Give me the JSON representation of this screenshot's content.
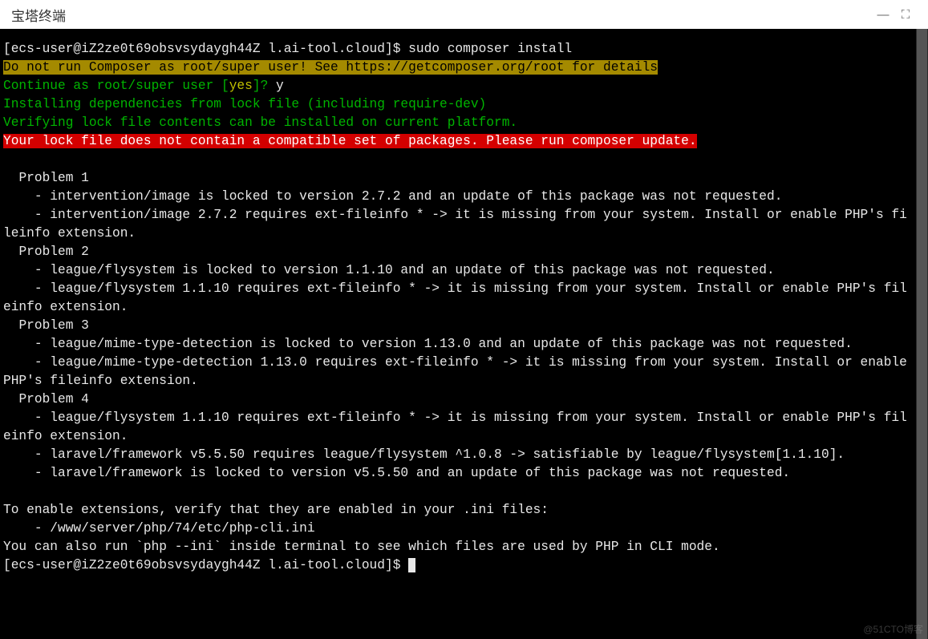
{
  "window": {
    "title": "宝塔终端",
    "minimize": "—",
    "expand": "⛶"
  },
  "term": {
    "prompt1_user": "[ecs-user@iZ2ze0t69obsvsydaygh44Z l.ai-tool.cloud]$ ",
    "cmd1": "sudo composer install",
    "root_warn": "Do not run Composer as root/super user! See https://getcomposer.org/root for details",
    "continue_q": "Continue as root/super user [",
    "continue_yes": "yes",
    "continue_q_end": "]? ",
    "continue_ans": "y",
    "install_dep": "Installing dependencies from lock file (including require-dev)",
    "verify": "Verifying lock file contents can be installed on current platform.",
    "lock_err": "Your lock file does not contain a compatible set of packages. Please run composer update.",
    "blank": " ",
    "p1_h": "  Problem 1",
    "p1_l1": "    - intervention/image is locked to version 2.7.2 and an update of this package was not requested.",
    "p1_l2": "    - intervention/image 2.7.2 requires ext-fileinfo * -> it is missing from your system. Install or enable PHP's fileinfo extension.",
    "p2_h": "  Problem 2",
    "p2_l1": "    - league/flysystem is locked to version 1.1.10 and an update of this package was not requested.",
    "p2_l2": "    - league/flysystem 1.1.10 requires ext-fileinfo * -> it is missing from your system. Install or enable PHP's fileinfo extension.",
    "p3_h": "  Problem 3",
    "p3_l1": "    - league/mime-type-detection is locked to version 1.13.0 and an update of this package was not requested.",
    "p3_l2": "    - league/mime-type-detection 1.13.0 requires ext-fileinfo * -> it is missing from your system. Install or enable PHP's fileinfo extension.",
    "p4_h": "  Problem 4",
    "p4_l1": "    - league/flysystem 1.1.10 requires ext-fileinfo * -> it is missing from your system. Install or enable PHP's fileinfo extension.",
    "p4_l2": "    - laravel/framework v5.5.50 requires league/flysystem ^1.0.8 -> satisfiable by league/flysystem[1.1.10].",
    "p4_l3": "    - laravel/framework is locked to version v5.5.50 and an update of this package was not requested.",
    "enable_ext": "To enable extensions, verify that they are enabled in your .ini files:",
    "ini_path": "    - /www/server/php/74/etc/php-cli.ini",
    "also_run": "You can also run `php --ini` inside terminal to see which files are used by PHP in CLI mode.",
    "prompt2_user": "[ecs-user@iZ2ze0t69obsvsydaygh44Z l.ai-tool.cloud]$ "
  },
  "watermark": "@51CTO博客"
}
